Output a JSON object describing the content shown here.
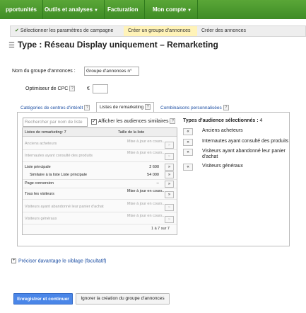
{
  "topnav": {
    "tabs": [
      {
        "label": "pportunités"
      },
      {
        "label": "Outils et analyses",
        "dropdown": true
      },
      {
        "label": "Facturation"
      },
      {
        "label": "Mon compte",
        "dropdown": true
      }
    ]
  },
  "breadcrumb": {
    "steps": [
      "Sélectionner les paramètres de campagne",
      "Créer un groupe d'annonces",
      "Créer des annonces"
    ],
    "done_mark": "✔"
  },
  "page": {
    "title": "Type :  Réseau Display uniquement – Remarketing"
  },
  "form": {
    "ad_group_label": "Nom du groupe d'annonces :",
    "ad_group_value": "Groupe d'annonces n°",
    "cpc_label": "Optimiseur de CPC",
    "currency": "€",
    "help": "?"
  },
  "tabs": {
    "items": [
      "Catégories de centres d'intérêt",
      "Listes de remarketing",
      "Combinaisons personnalisées"
    ]
  },
  "list": {
    "search_placeholder": "Rechercher par nom de liste",
    "show_similar_label": "Afficher les audiences similaires",
    "header_name": "Listes de remarketing",
    "header_count": "7",
    "header_size": "Taille de la liste",
    "rows": [
      {
        "name": "Anciens acheteurs",
        "value": "Mise à jour en cours...",
        "dim": true
      },
      {
        "name": "Internautes ayant consulté des produits",
        "value": "Mise à jour en cours...",
        "dim": true
      },
      {
        "name": "Liste principale",
        "value": "2 600",
        "dim": false
      },
      {
        "name": "Similaire à la liste Liste principale",
        "value": "54 000",
        "dim": false
      },
      {
        "name": "Page conversion",
        "value": "--",
        "dim": false
      },
      {
        "name": "Tous les visiteurs",
        "value": "Mise à jour en cours...",
        "dim": false
      },
      {
        "name": "Visiteurs ayant abandonné leur panier d'achat",
        "value": "Mise à jour en cours...",
        "dim": true
      },
      {
        "name": "Visiteurs généraux",
        "value": "Mise à jour en cours...",
        "dim": true
      }
    ],
    "pager": "1 à 7 sur 7"
  },
  "selected": {
    "title": "Types d'audience sélectionnés :",
    "count": "4",
    "items": [
      "Anciens acheteurs",
      "Internautes ayant consulté des produits",
      "Visiteurs ayant abandonné leur panier d'achat",
      "Visiteurs généraux"
    ]
  },
  "refine": {
    "label": "Préciser davantage le ciblage (facultatif)"
  },
  "buttons": {
    "save": "Enregistrer et continuer",
    "skip": "Ignorer la création du groupe d'annonces"
  },
  "colors": {
    "nav_green": "#4f9a30",
    "link_blue": "#1c4ea3",
    "primary_blue": "#4a86e8",
    "active_step": "#fff3b8"
  }
}
